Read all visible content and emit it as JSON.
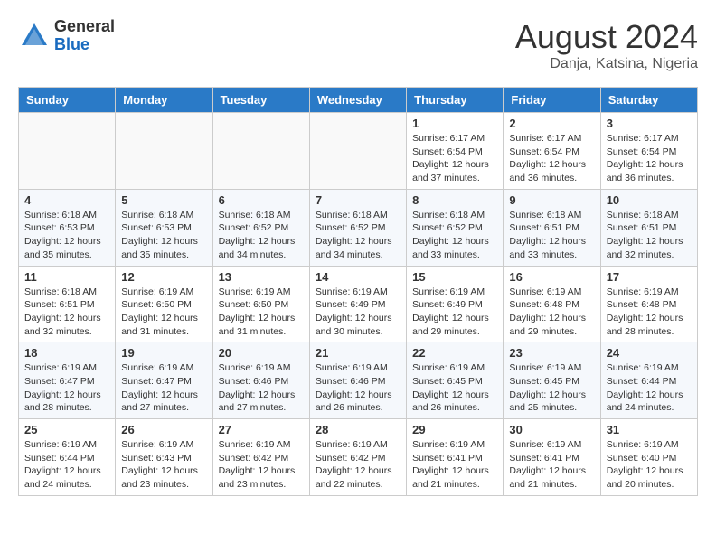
{
  "header": {
    "logo_general": "General",
    "logo_blue": "Blue",
    "month_year": "August 2024",
    "location": "Danja, Katsina, Nigeria"
  },
  "days_of_week": [
    "Sunday",
    "Monday",
    "Tuesday",
    "Wednesday",
    "Thursday",
    "Friday",
    "Saturday"
  ],
  "weeks": [
    [
      {
        "day": "",
        "info": ""
      },
      {
        "day": "",
        "info": ""
      },
      {
        "day": "",
        "info": ""
      },
      {
        "day": "",
        "info": ""
      },
      {
        "day": "1",
        "info": "Sunrise: 6:17 AM\nSunset: 6:54 PM\nDaylight: 12 hours and 37 minutes."
      },
      {
        "day": "2",
        "info": "Sunrise: 6:17 AM\nSunset: 6:54 PM\nDaylight: 12 hours and 36 minutes."
      },
      {
        "day": "3",
        "info": "Sunrise: 6:17 AM\nSunset: 6:54 PM\nDaylight: 12 hours and 36 minutes."
      }
    ],
    [
      {
        "day": "4",
        "info": "Sunrise: 6:18 AM\nSunset: 6:53 PM\nDaylight: 12 hours and 35 minutes."
      },
      {
        "day": "5",
        "info": "Sunrise: 6:18 AM\nSunset: 6:53 PM\nDaylight: 12 hours and 35 minutes."
      },
      {
        "day": "6",
        "info": "Sunrise: 6:18 AM\nSunset: 6:52 PM\nDaylight: 12 hours and 34 minutes."
      },
      {
        "day": "7",
        "info": "Sunrise: 6:18 AM\nSunset: 6:52 PM\nDaylight: 12 hours and 34 minutes."
      },
      {
        "day": "8",
        "info": "Sunrise: 6:18 AM\nSunset: 6:52 PM\nDaylight: 12 hours and 33 minutes."
      },
      {
        "day": "9",
        "info": "Sunrise: 6:18 AM\nSunset: 6:51 PM\nDaylight: 12 hours and 33 minutes."
      },
      {
        "day": "10",
        "info": "Sunrise: 6:18 AM\nSunset: 6:51 PM\nDaylight: 12 hours and 32 minutes."
      }
    ],
    [
      {
        "day": "11",
        "info": "Sunrise: 6:18 AM\nSunset: 6:51 PM\nDaylight: 12 hours and 32 minutes."
      },
      {
        "day": "12",
        "info": "Sunrise: 6:19 AM\nSunset: 6:50 PM\nDaylight: 12 hours and 31 minutes."
      },
      {
        "day": "13",
        "info": "Sunrise: 6:19 AM\nSunset: 6:50 PM\nDaylight: 12 hours and 31 minutes."
      },
      {
        "day": "14",
        "info": "Sunrise: 6:19 AM\nSunset: 6:49 PM\nDaylight: 12 hours and 30 minutes."
      },
      {
        "day": "15",
        "info": "Sunrise: 6:19 AM\nSunset: 6:49 PM\nDaylight: 12 hours and 29 minutes."
      },
      {
        "day": "16",
        "info": "Sunrise: 6:19 AM\nSunset: 6:48 PM\nDaylight: 12 hours and 29 minutes."
      },
      {
        "day": "17",
        "info": "Sunrise: 6:19 AM\nSunset: 6:48 PM\nDaylight: 12 hours and 28 minutes."
      }
    ],
    [
      {
        "day": "18",
        "info": "Sunrise: 6:19 AM\nSunset: 6:47 PM\nDaylight: 12 hours and 28 minutes."
      },
      {
        "day": "19",
        "info": "Sunrise: 6:19 AM\nSunset: 6:47 PM\nDaylight: 12 hours and 27 minutes."
      },
      {
        "day": "20",
        "info": "Sunrise: 6:19 AM\nSunset: 6:46 PM\nDaylight: 12 hours and 27 minutes."
      },
      {
        "day": "21",
        "info": "Sunrise: 6:19 AM\nSunset: 6:46 PM\nDaylight: 12 hours and 26 minutes."
      },
      {
        "day": "22",
        "info": "Sunrise: 6:19 AM\nSunset: 6:45 PM\nDaylight: 12 hours and 26 minutes."
      },
      {
        "day": "23",
        "info": "Sunrise: 6:19 AM\nSunset: 6:45 PM\nDaylight: 12 hours and 25 minutes."
      },
      {
        "day": "24",
        "info": "Sunrise: 6:19 AM\nSunset: 6:44 PM\nDaylight: 12 hours and 24 minutes."
      }
    ],
    [
      {
        "day": "25",
        "info": "Sunrise: 6:19 AM\nSunset: 6:44 PM\nDaylight: 12 hours and 24 minutes."
      },
      {
        "day": "26",
        "info": "Sunrise: 6:19 AM\nSunset: 6:43 PM\nDaylight: 12 hours and 23 minutes."
      },
      {
        "day": "27",
        "info": "Sunrise: 6:19 AM\nSunset: 6:42 PM\nDaylight: 12 hours and 23 minutes."
      },
      {
        "day": "28",
        "info": "Sunrise: 6:19 AM\nSunset: 6:42 PM\nDaylight: 12 hours and 22 minutes."
      },
      {
        "day": "29",
        "info": "Sunrise: 6:19 AM\nSunset: 6:41 PM\nDaylight: 12 hours and 21 minutes."
      },
      {
        "day": "30",
        "info": "Sunrise: 6:19 AM\nSunset: 6:41 PM\nDaylight: 12 hours and 21 minutes."
      },
      {
        "day": "31",
        "info": "Sunrise: 6:19 AM\nSunset: 6:40 PM\nDaylight: 12 hours and 20 minutes."
      }
    ]
  ]
}
